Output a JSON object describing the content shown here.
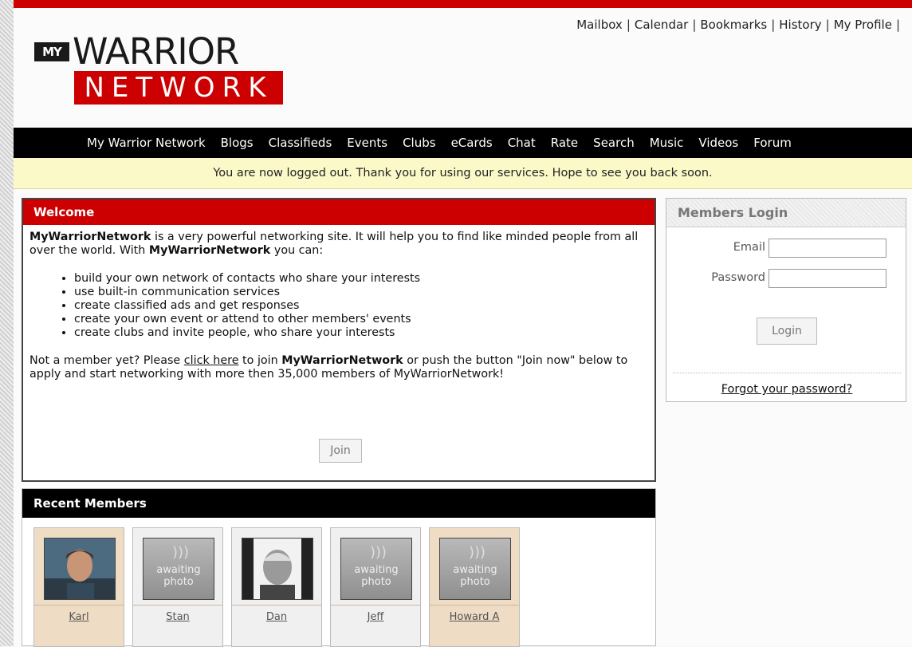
{
  "toplinks": [
    "Mailbox",
    "Calendar",
    "Bookmarks",
    "History",
    "My Profile"
  ],
  "logo": {
    "my": "MY",
    "warrior": "WARRIOR",
    "network": "NETWORK"
  },
  "nav": [
    "My Warrior Network",
    "Blogs",
    "Classifieds",
    "Events",
    "Clubs",
    "eCards",
    "Chat",
    "Rate",
    "Search",
    "Music",
    "Videos",
    "Forum"
  ],
  "notice": "You are now logged out. Thank you for using our services. Hope to see you back soon.",
  "welcome": {
    "title": "Welcome",
    "brand": "MyWarriorNetwork",
    "intro_rest": " is a very powerful networking site. It will help you to find like minded people from all over the world. With ",
    "intro_end": " you can:",
    "bullets": [
      "build your own network of contacts who share your interests",
      "use built-in communication services",
      "create classified ads and get responses",
      "create your own event or attend to other members' events",
      "create clubs and invite people, who share your interests"
    ],
    "cta_start": "Not a member yet? Please ",
    "cta_link": "click here",
    "cta_mid": " to join ",
    "cta_end": " or push the button \"Join now\" below to apply and start networking with more then 35,000 members of MyWarriorNetwork!",
    "join_label": "Join"
  },
  "login": {
    "title": "Members Login",
    "email_label": "Email",
    "password_label": "Password",
    "button_label": "Login",
    "forgot_label": "Forgot your password?"
  },
  "recent": {
    "title": "Recent Members",
    "awaiting_text": "awaiting photo",
    "members": [
      {
        "name": "Karl"
      },
      {
        "name": "Stan"
      },
      {
        "name": "Dan"
      },
      {
        "name": "Jeff"
      },
      {
        "name": "Howard A"
      }
    ]
  },
  "colors": {
    "brand_red": "#cc0000",
    "nav_black": "#000000",
    "notice_yellow": "#fbf9c7"
  }
}
